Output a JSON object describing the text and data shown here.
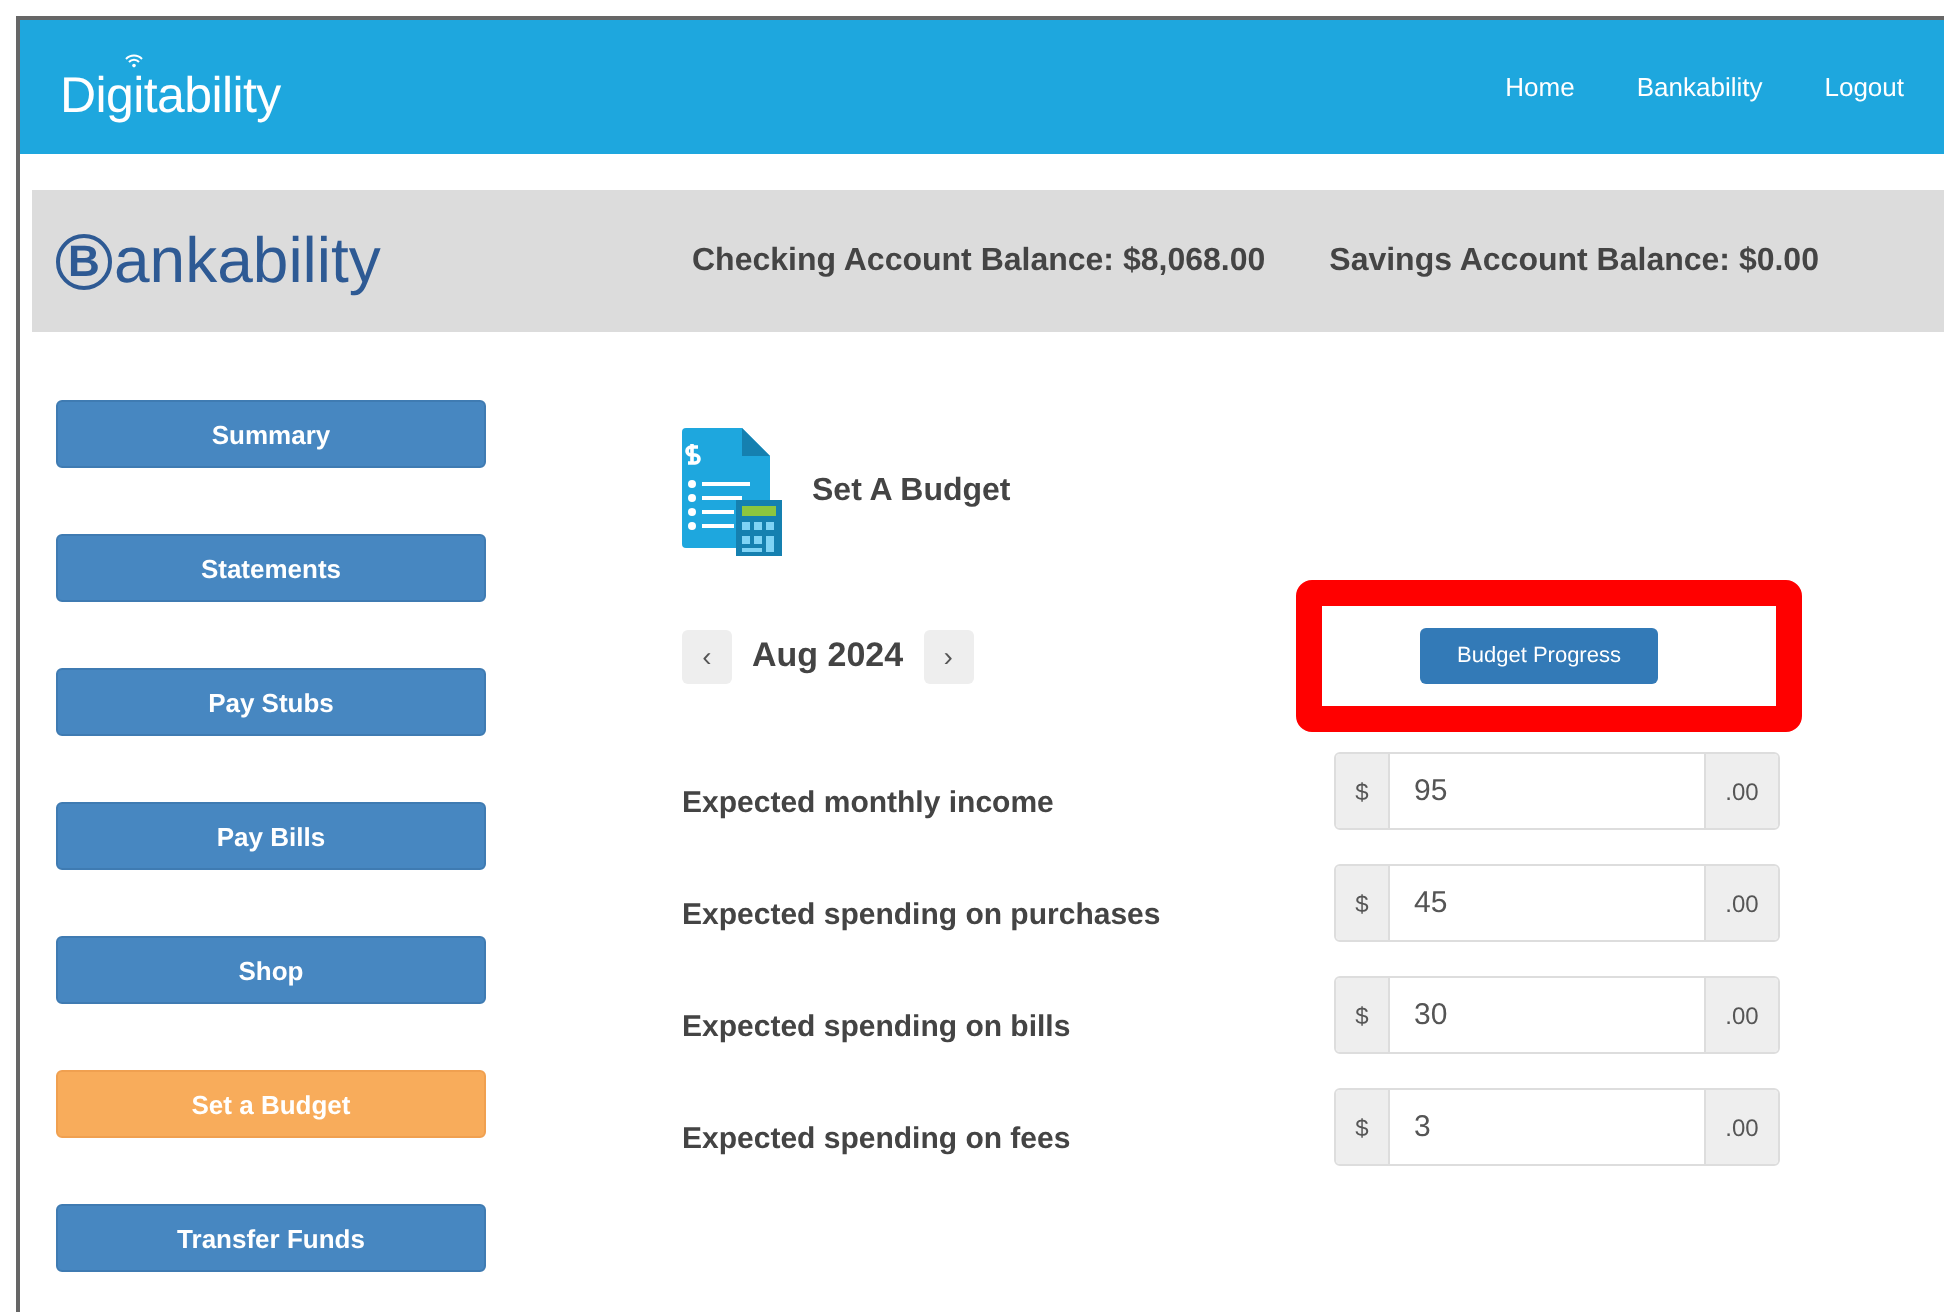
{
  "brand": "Digitability",
  "nav": [
    {
      "label": "Home"
    },
    {
      "label": "Bankability"
    },
    {
      "label": "Logout"
    }
  ],
  "bank_logo": {
    "badge": "B",
    "text": "ankability"
  },
  "balances": [
    "Checking Account Balance: $8,068.00",
    "Savings Account Balance: $0.00"
  ],
  "sidebar": [
    {
      "label": "Summary",
      "selected": false
    },
    {
      "label": "Statements",
      "selected": false
    },
    {
      "label": "Pay Stubs",
      "selected": false
    },
    {
      "label": "Pay Bills",
      "selected": false
    },
    {
      "label": "Shop",
      "selected": false
    },
    {
      "label": "Set a Budget",
      "selected": true
    },
    {
      "label": "Transfer Funds",
      "selected": false
    }
  ],
  "page_title": "Set A Budget",
  "month": {
    "prev": "‹",
    "label": "Aug 2024",
    "next": "›"
  },
  "progress_button": {
    "label": "Budget Progress",
    "highlighted": true
  },
  "fields": [
    {
      "label": "Expected monthly income",
      "prefix": "$",
      "value": "95",
      "suffix": ".00"
    },
    {
      "label": "Expected spending on purchases",
      "prefix": "$",
      "value": "45",
      "suffix": ".00"
    },
    {
      "label": "Expected spending on bills",
      "prefix": "$",
      "value": "30",
      "suffix": ".00"
    },
    {
      "label": "Expected spending on fees",
      "prefix": "$",
      "value": "3",
      "suffix": ".00"
    }
  ]
}
